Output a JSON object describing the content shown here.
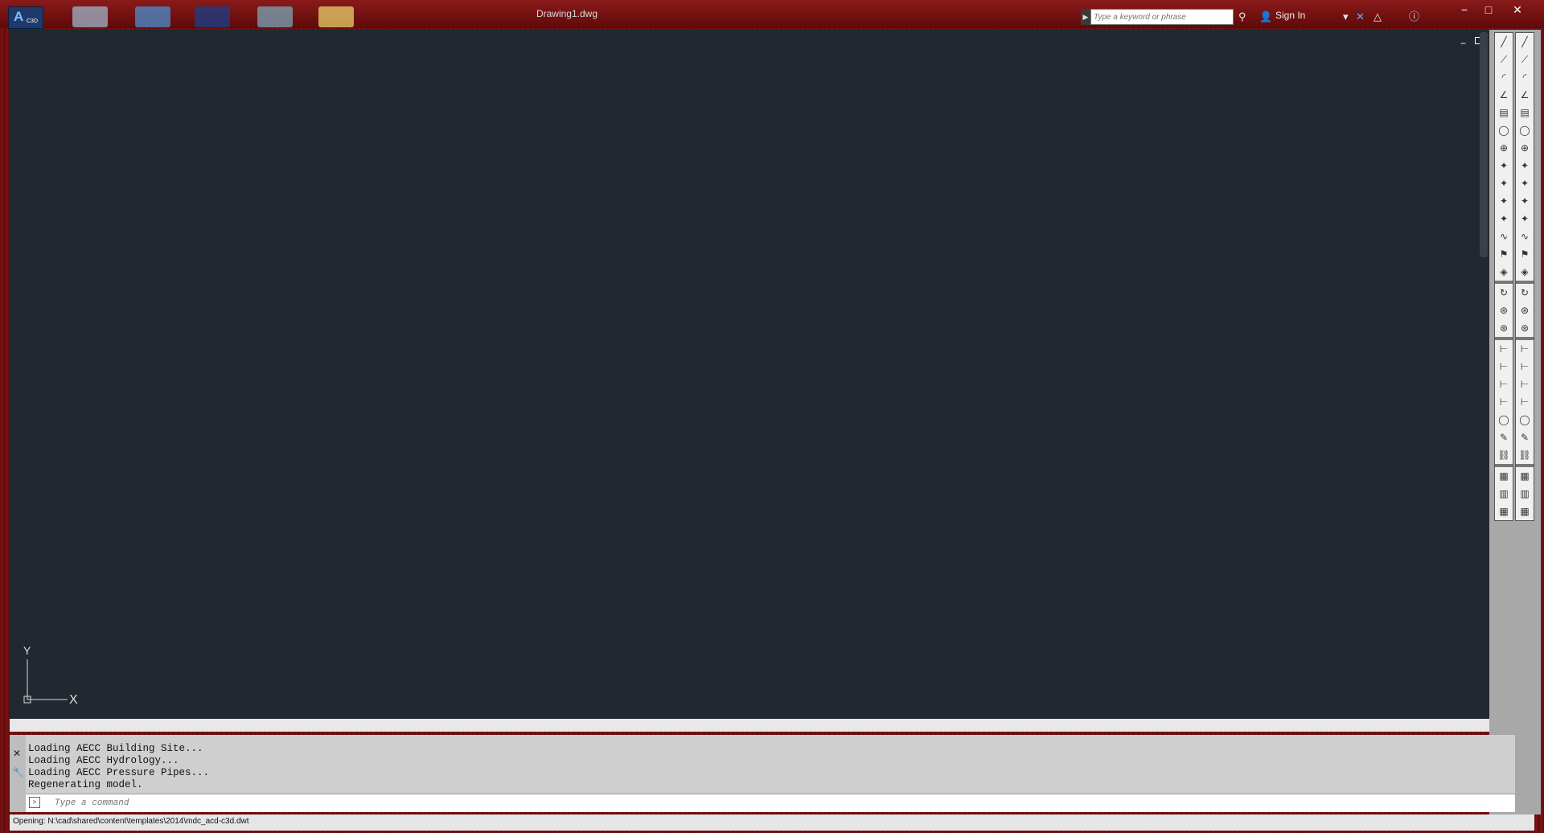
{
  "titlebar": {
    "app_logo": "A",
    "app_tag": "C3D",
    "doc_title": "Drawing1.dwg",
    "search_placeholder": "Type a keyword or phrase",
    "sign_in": "Sign In",
    "window_controls": [
      "minimize",
      "maximize",
      "close"
    ]
  },
  "qat": [
    "open",
    "drawing",
    "brand",
    "blocks",
    "folder"
  ],
  "viewport": {
    "axis_x": "X",
    "axis_y": "Y"
  },
  "palette_icons": [
    "line-icon",
    "polyline-icon",
    "arc-icon",
    "angle-icon",
    "doc-icon",
    "circle-icon",
    "sphere-icon",
    "point-icon",
    "point-icon",
    "point-icon",
    "point-icon",
    "curve-icon",
    "flag-icon",
    "feature-icon",
    "rotate-icon",
    "node-icon",
    "node-icon",
    "dim-icon",
    "dim-icon",
    "dim-icon",
    "dim-icon",
    "circle-icon",
    "edit-icon",
    "link-icon",
    "grid-icon",
    "table-icon",
    "grid-icon"
  ],
  "command_line": {
    "history": [
      "Loading AECC Building Site...",
      "Loading AECC Hydrology...",
      "Loading AECC Pressure Pipes...",
      "Regenerating model."
    ],
    "placeholder": "Type a command"
  },
  "status": {
    "text": "Opening: N:\\cad\\shared\\content\\templates\\2014\\mdc_acd-c3d.dwt"
  },
  "colors": {
    "canvas_bg": "#212830",
    "frame_red": "#7c1414"
  }
}
